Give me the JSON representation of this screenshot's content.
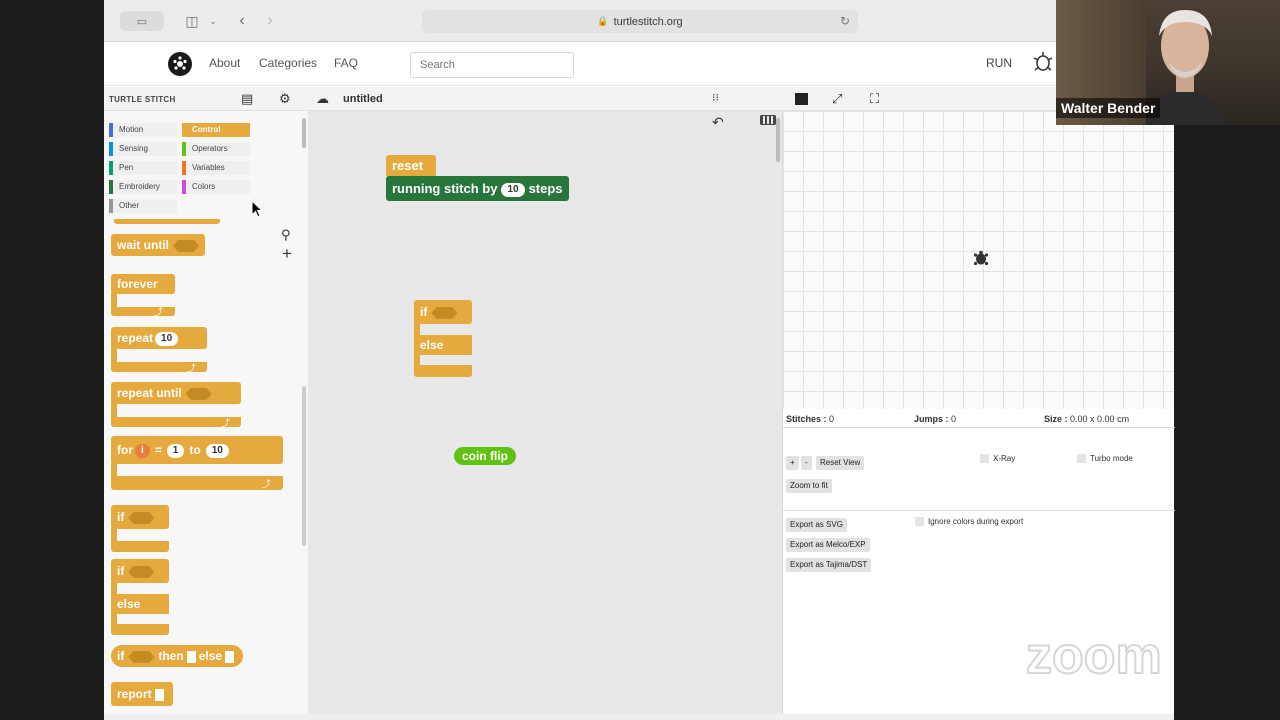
{
  "browser": {
    "url": "turtlestitch.org"
  },
  "site_nav": {
    "links": [
      "About",
      "Categories",
      "FAQ"
    ],
    "search_placeholder": "Search",
    "run_label": "RUN"
  },
  "snap_bar": {
    "logo_text": "TURTLE STITCH",
    "project_name": "untitled"
  },
  "categories": [
    {
      "label": "Motion",
      "color": "#4a6cd4",
      "active": false
    },
    {
      "label": "Control",
      "color": "#e5a93d",
      "active": true
    },
    {
      "label": "Sensing",
      "color": "#0494dc",
      "active": false
    },
    {
      "label": "Operators",
      "color": "#62c213",
      "active": false
    },
    {
      "label": "Pen",
      "color": "#00a178",
      "active": false
    },
    {
      "label": "Variables",
      "color": "#f3761d",
      "active": false
    },
    {
      "label": "Embroidery",
      "color": "#29763d",
      "active": false
    },
    {
      "label": "Colors",
      "color": "#cf4add",
      "active": false
    },
    {
      "label": "Other",
      "color": "#969696",
      "active": false
    }
  ],
  "palette_blocks": {
    "wait_until": "wait until",
    "forever": "forever",
    "repeat": "repeat",
    "repeat_count": "10",
    "repeat_until": "repeat until",
    "for": "for",
    "for_var": "i",
    "for_eq": "=",
    "for_from": "1",
    "for_to": "to",
    "for_end": "10",
    "if1": "if",
    "if2": "if",
    "else": "else",
    "if_reporter": "if",
    "then": "then",
    "else_reporter": "else",
    "report": "report"
  },
  "script_blocks": {
    "reset": "reset",
    "running_stitch_by": "running stitch by",
    "running_stitch_value": "10",
    "steps": "steps",
    "if": "if",
    "else": "else",
    "coin_flip": "coin flip"
  },
  "stage_info": {
    "stitches_label": "Stitches :",
    "stitches_value": "0",
    "jumps_label": "Jumps :",
    "jumps_value": "0",
    "size_label": "Size :",
    "size_value": "0.00 x 0.00 cm"
  },
  "stage_controls": {
    "plus": "+",
    "minus": "-",
    "reset_view": "Reset View",
    "zoom_to_fit": "Zoom to fit",
    "xray": "X-Ray",
    "turbo": "Turbo mode",
    "export_svg": "Export as SVG",
    "export_melco": "Export as Melco/EXP",
    "export_tajima": "Export as Tajima/DST",
    "ignore_colors": "Ignore colors during export"
  },
  "video": {
    "participant_name": "Walter Bender"
  },
  "watermark": "zoom",
  "colors": {
    "control": "#e5a93d",
    "embroidery": "#29763d",
    "operators": "#62c213",
    "variables": "#f3761d"
  }
}
